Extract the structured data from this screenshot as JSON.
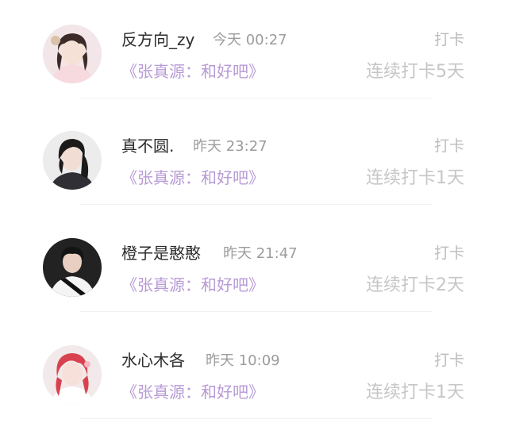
{
  "feed": {
    "items": [
      {
        "user": "反方向_zy",
        "time": "今天 00:27",
        "action": "打卡",
        "song": "《张真源：和好吧》",
        "streak": "连续打卡5天",
        "avatar_icon": "user-avatar"
      },
      {
        "user": "真不圆.",
        "time": "昨天 23:27",
        "action": "打卡",
        "song": "《张真源：和好吧》",
        "streak": "连续打卡1天",
        "avatar_icon": "user-avatar"
      },
      {
        "user": "橙子是憨憨",
        "time": "昨天 21:47",
        "action": "打卡",
        "song": "《张真源：和好吧》",
        "streak": "连续打卡2天",
        "avatar_icon": "user-avatar"
      },
      {
        "user": "水心木各",
        "time": "昨天 10:09",
        "action": "打卡",
        "song": "《张真源：和好吧》",
        "streak": "连续打卡1天",
        "avatar_icon": "user-avatar"
      }
    ]
  },
  "colors": {
    "name": "#2b2b2b",
    "time": "#9c9c9c",
    "song": "#b79ad6",
    "streak": "#c6c6c6",
    "action": "#bdbdbd"
  }
}
